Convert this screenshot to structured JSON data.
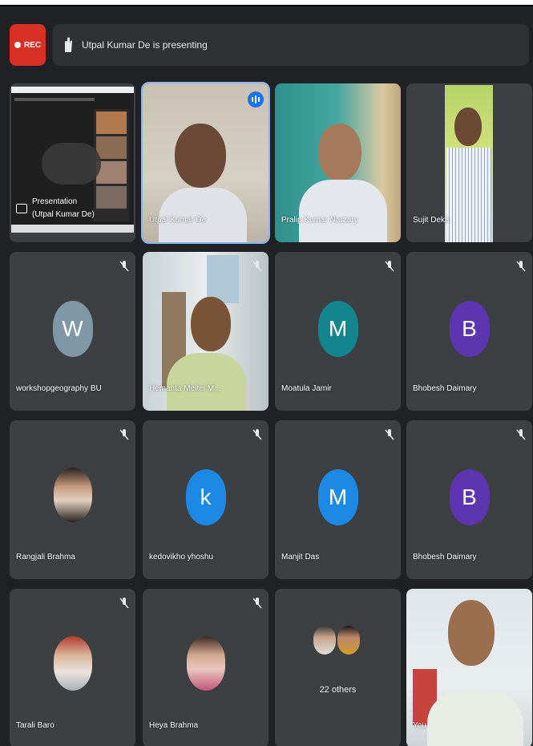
{
  "recording": {
    "label": "REC",
    "color": "#d93025"
  },
  "presenting_banner": {
    "text": "Utpal Kumar De is presenting",
    "icon": "raised-hand-icon"
  },
  "tiles": [
    {
      "id": "presentation",
      "name": "Presentation\n(Utpal Kumar De)",
      "type": "presentation",
      "muted": false
    },
    {
      "id": "utpal",
      "name": "Utpal Kumar De",
      "type": "video",
      "speaking": true
    },
    {
      "id": "pralip",
      "name": "Pralip Kumar Narzary",
      "type": "video",
      "muted": false
    },
    {
      "id": "sujit",
      "name": "Sujit Deka",
      "type": "video",
      "muted": false
    },
    {
      "id": "workshop",
      "name": "workshopgeography BU",
      "type": "avatar",
      "initial": "W",
      "color": "#7e98a8",
      "muted": true
    },
    {
      "id": "hemanta",
      "name": "Hemanta Meitei M...",
      "type": "video",
      "muted": true
    },
    {
      "id": "moatula",
      "name": "Moatula Jamir",
      "type": "avatar",
      "initial": "M",
      "color": "#12858f",
      "muted": true
    },
    {
      "id": "bhobesh1",
      "name": "Bhobesh Daimary",
      "type": "avatar",
      "initial": "B",
      "color": "#5e35b1",
      "muted": true
    },
    {
      "id": "rangjali",
      "name": "Rangjali Brahma",
      "type": "photo",
      "muted": true
    },
    {
      "id": "kedovikho",
      "name": "kedovikho yhoshu",
      "type": "avatar",
      "initial": "k",
      "color": "#1e88e5",
      "muted": true
    },
    {
      "id": "manjit",
      "name": "Manjit Das",
      "type": "avatar",
      "initial": "M",
      "color": "#1e88e5",
      "muted": true
    },
    {
      "id": "bhobesh2",
      "name": "Bhobesh Daimary",
      "type": "avatar",
      "initial": "B",
      "color": "#5e35b1",
      "muted": true
    },
    {
      "id": "tarali",
      "name": "Tarali Baro",
      "type": "photo",
      "muted": true
    },
    {
      "id": "heya",
      "name": "Heya Brahma",
      "type": "photo",
      "muted": true
    },
    {
      "id": "others",
      "name": "22 others",
      "type": "others"
    },
    {
      "id": "you",
      "name": "You",
      "type": "video"
    }
  ]
}
